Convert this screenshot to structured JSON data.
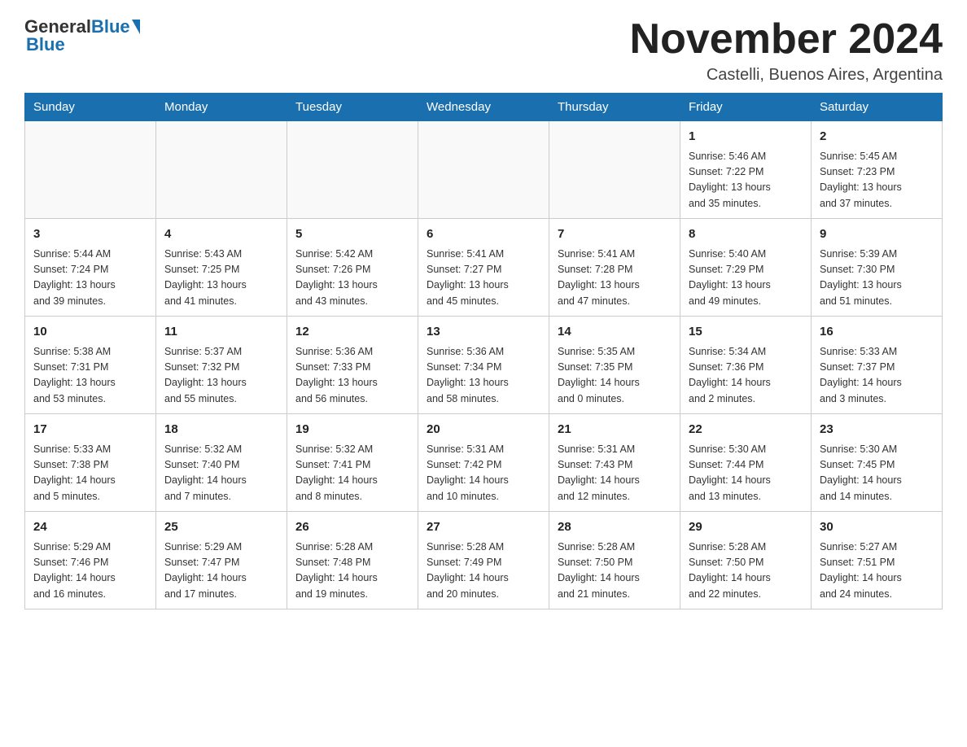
{
  "header": {
    "logo_text_general": "General",
    "logo_text_blue": "Blue",
    "month_title": "November 2024",
    "location": "Castelli, Buenos Aires, Argentina"
  },
  "weekdays": [
    "Sunday",
    "Monday",
    "Tuesday",
    "Wednesday",
    "Thursday",
    "Friday",
    "Saturday"
  ],
  "weeks": [
    [
      {
        "day": "",
        "info": ""
      },
      {
        "day": "",
        "info": ""
      },
      {
        "day": "",
        "info": ""
      },
      {
        "day": "",
        "info": ""
      },
      {
        "day": "",
        "info": ""
      },
      {
        "day": "1",
        "info": "Sunrise: 5:46 AM\nSunset: 7:22 PM\nDaylight: 13 hours\nand 35 minutes."
      },
      {
        "day": "2",
        "info": "Sunrise: 5:45 AM\nSunset: 7:23 PM\nDaylight: 13 hours\nand 37 minutes."
      }
    ],
    [
      {
        "day": "3",
        "info": "Sunrise: 5:44 AM\nSunset: 7:24 PM\nDaylight: 13 hours\nand 39 minutes."
      },
      {
        "day": "4",
        "info": "Sunrise: 5:43 AM\nSunset: 7:25 PM\nDaylight: 13 hours\nand 41 minutes."
      },
      {
        "day": "5",
        "info": "Sunrise: 5:42 AM\nSunset: 7:26 PM\nDaylight: 13 hours\nand 43 minutes."
      },
      {
        "day": "6",
        "info": "Sunrise: 5:41 AM\nSunset: 7:27 PM\nDaylight: 13 hours\nand 45 minutes."
      },
      {
        "day": "7",
        "info": "Sunrise: 5:41 AM\nSunset: 7:28 PM\nDaylight: 13 hours\nand 47 minutes."
      },
      {
        "day": "8",
        "info": "Sunrise: 5:40 AM\nSunset: 7:29 PM\nDaylight: 13 hours\nand 49 minutes."
      },
      {
        "day": "9",
        "info": "Sunrise: 5:39 AM\nSunset: 7:30 PM\nDaylight: 13 hours\nand 51 minutes."
      }
    ],
    [
      {
        "day": "10",
        "info": "Sunrise: 5:38 AM\nSunset: 7:31 PM\nDaylight: 13 hours\nand 53 minutes."
      },
      {
        "day": "11",
        "info": "Sunrise: 5:37 AM\nSunset: 7:32 PM\nDaylight: 13 hours\nand 55 minutes."
      },
      {
        "day": "12",
        "info": "Sunrise: 5:36 AM\nSunset: 7:33 PM\nDaylight: 13 hours\nand 56 minutes."
      },
      {
        "day": "13",
        "info": "Sunrise: 5:36 AM\nSunset: 7:34 PM\nDaylight: 13 hours\nand 58 minutes."
      },
      {
        "day": "14",
        "info": "Sunrise: 5:35 AM\nSunset: 7:35 PM\nDaylight: 14 hours\nand 0 minutes."
      },
      {
        "day": "15",
        "info": "Sunrise: 5:34 AM\nSunset: 7:36 PM\nDaylight: 14 hours\nand 2 minutes."
      },
      {
        "day": "16",
        "info": "Sunrise: 5:33 AM\nSunset: 7:37 PM\nDaylight: 14 hours\nand 3 minutes."
      }
    ],
    [
      {
        "day": "17",
        "info": "Sunrise: 5:33 AM\nSunset: 7:38 PM\nDaylight: 14 hours\nand 5 minutes."
      },
      {
        "day": "18",
        "info": "Sunrise: 5:32 AM\nSunset: 7:40 PM\nDaylight: 14 hours\nand 7 minutes."
      },
      {
        "day": "19",
        "info": "Sunrise: 5:32 AM\nSunset: 7:41 PM\nDaylight: 14 hours\nand 8 minutes."
      },
      {
        "day": "20",
        "info": "Sunrise: 5:31 AM\nSunset: 7:42 PM\nDaylight: 14 hours\nand 10 minutes."
      },
      {
        "day": "21",
        "info": "Sunrise: 5:31 AM\nSunset: 7:43 PM\nDaylight: 14 hours\nand 12 minutes."
      },
      {
        "day": "22",
        "info": "Sunrise: 5:30 AM\nSunset: 7:44 PM\nDaylight: 14 hours\nand 13 minutes."
      },
      {
        "day": "23",
        "info": "Sunrise: 5:30 AM\nSunset: 7:45 PM\nDaylight: 14 hours\nand 14 minutes."
      }
    ],
    [
      {
        "day": "24",
        "info": "Sunrise: 5:29 AM\nSunset: 7:46 PM\nDaylight: 14 hours\nand 16 minutes."
      },
      {
        "day": "25",
        "info": "Sunrise: 5:29 AM\nSunset: 7:47 PM\nDaylight: 14 hours\nand 17 minutes."
      },
      {
        "day": "26",
        "info": "Sunrise: 5:28 AM\nSunset: 7:48 PM\nDaylight: 14 hours\nand 19 minutes."
      },
      {
        "day": "27",
        "info": "Sunrise: 5:28 AM\nSunset: 7:49 PM\nDaylight: 14 hours\nand 20 minutes."
      },
      {
        "day": "28",
        "info": "Sunrise: 5:28 AM\nSunset: 7:50 PM\nDaylight: 14 hours\nand 21 minutes."
      },
      {
        "day": "29",
        "info": "Sunrise: 5:28 AM\nSunset: 7:50 PM\nDaylight: 14 hours\nand 22 minutes."
      },
      {
        "day": "30",
        "info": "Sunrise: 5:27 AM\nSunset: 7:51 PM\nDaylight: 14 hours\nand 24 minutes."
      }
    ]
  ]
}
